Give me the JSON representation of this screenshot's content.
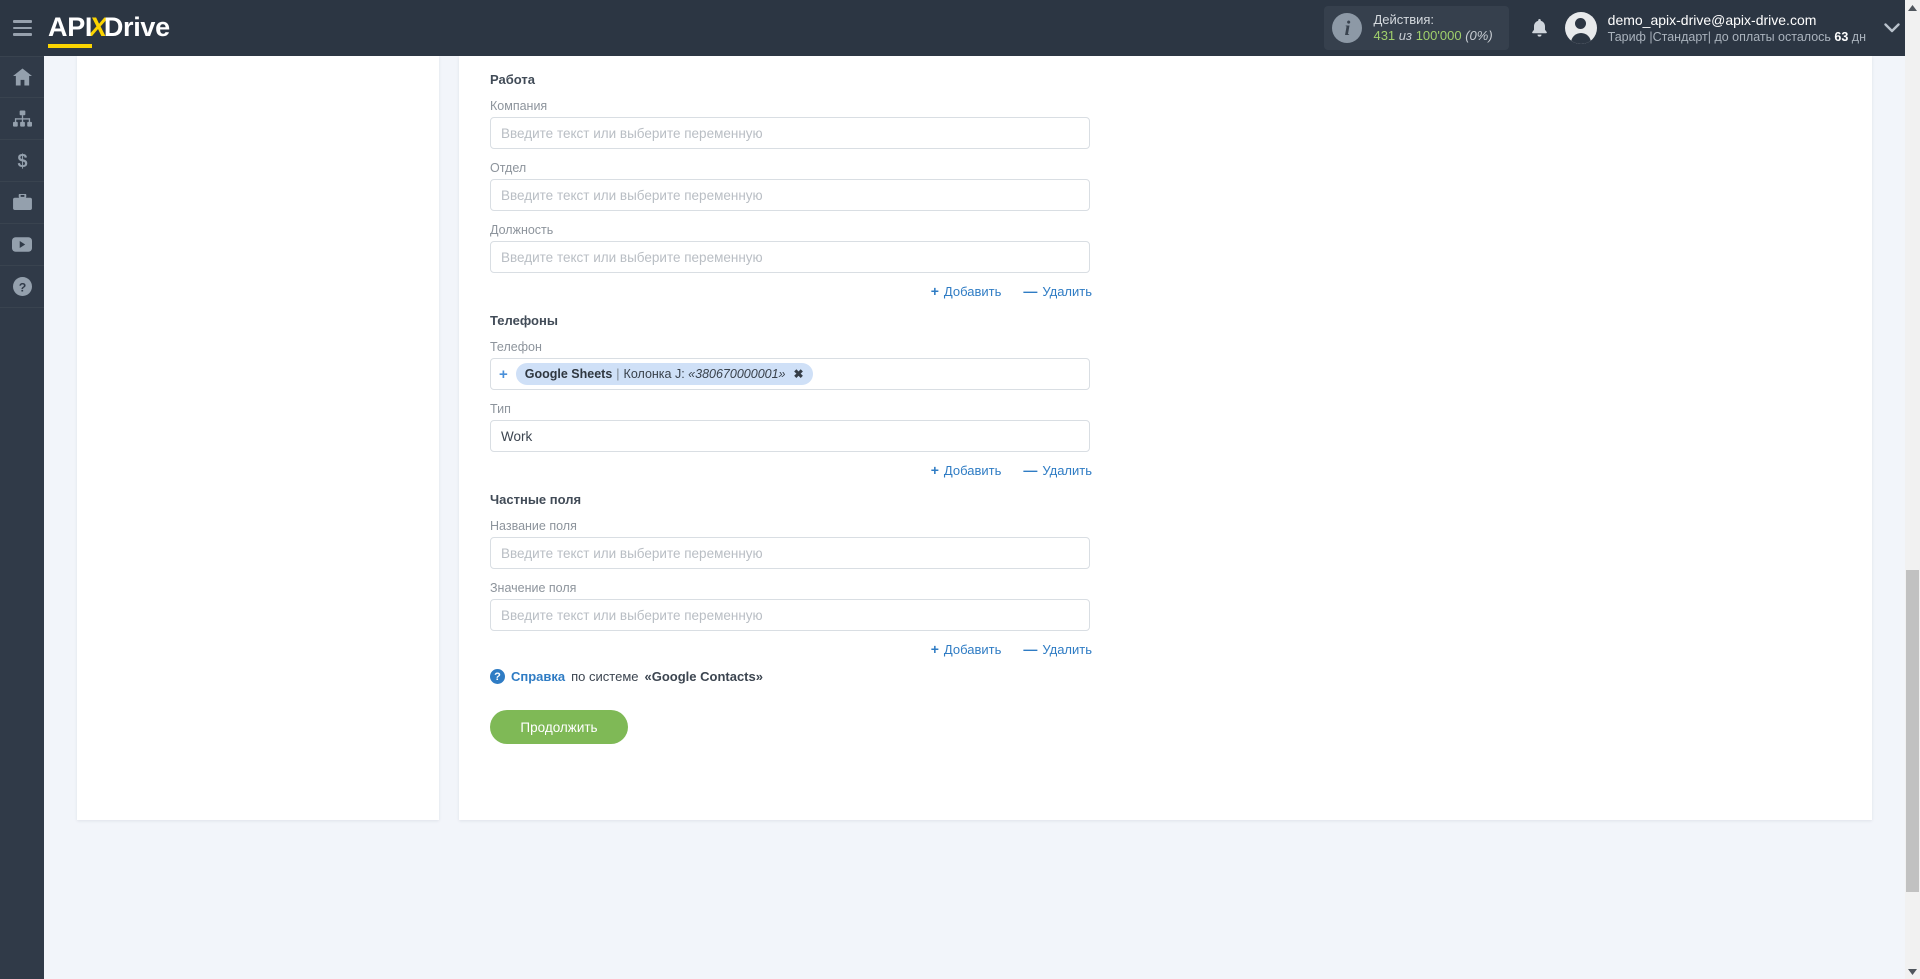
{
  "topbar": {
    "menu_icon": "hamburger-menu-icon",
    "logo": {
      "part1": "API",
      "x": "X",
      "part2": "Drive"
    },
    "actions": {
      "icon": "info-icon",
      "title": "Действия:",
      "used": "431",
      "of_word": "из",
      "total": "100'000",
      "percent": "(0%)"
    },
    "notifications_icon": "bell-icon",
    "user": {
      "avatar_icon": "user-avatar-icon",
      "email": "demo_apix-drive@apix-drive.com",
      "plan_prefix": "Тариф |Стандарт| до оплаты осталось ",
      "plan_days": "63",
      "plan_suffix": " дн"
    },
    "dropdown_icon": "chevron-down-icon"
  },
  "sidebar": {
    "items": [
      {
        "name": "home",
        "icon": "home-icon"
      },
      {
        "name": "connections",
        "icon": "sitemap-icon"
      },
      {
        "name": "billing",
        "icon": "dollar-icon"
      },
      {
        "name": "services",
        "icon": "briefcase-icon"
      },
      {
        "name": "video",
        "icon": "youtube-icon"
      },
      {
        "name": "help",
        "icon": "question-circle-icon"
      }
    ]
  },
  "form": {
    "placeholder": "Введите текст или выберите переменную",
    "sections": [
      {
        "title": "Работа",
        "fields": [
          {
            "label": "Компания",
            "value": ""
          },
          {
            "label": "Отдел",
            "value": ""
          },
          {
            "label": "Должность",
            "value": ""
          }
        ]
      },
      {
        "title": "Телефоны",
        "fields": [
          {
            "label": "Телефон",
            "value": ""
          },
          {
            "label": "Тип",
            "value": "Work"
          }
        ]
      },
      {
        "title": "Частные поля",
        "fields": [
          {
            "label": "Название поля",
            "value": ""
          },
          {
            "label": "Значение поля",
            "value": ""
          }
        ]
      }
    ],
    "chip": {
      "source": "Google Sheets",
      "separator": "|",
      "column": "Колонка J:",
      "value": "«380670000001»",
      "remove_icon": "close-icon",
      "add_icon": "plus-icon"
    },
    "add_label": "Добавить",
    "add_symbol": "+",
    "remove_label": "Удалить",
    "remove_symbol": "—",
    "help": {
      "icon": "question-circle-icon",
      "link_text": "Справка",
      "middle_text": " по системе ",
      "system_name": "«Google Contacts»"
    },
    "continue_button": "Продолжить"
  },
  "scrollbar": {
    "up_icon": "scroll-up-arrow-icon",
    "down_icon": "scroll-down-arrow-icon",
    "thumb": "scrollbar-thumb"
  },
  "colors": {
    "topbar_bg": "#2c3643",
    "sidebar_bg": "#303a48",
    "accent_yellow": "#fbd400",
    "link_blue": "#2f7cc4",
    "green_button": "#7fb956",
    "chip_bg": "#cfe0f7",
    "page_bg": "#f2f5fa"
  }
}
